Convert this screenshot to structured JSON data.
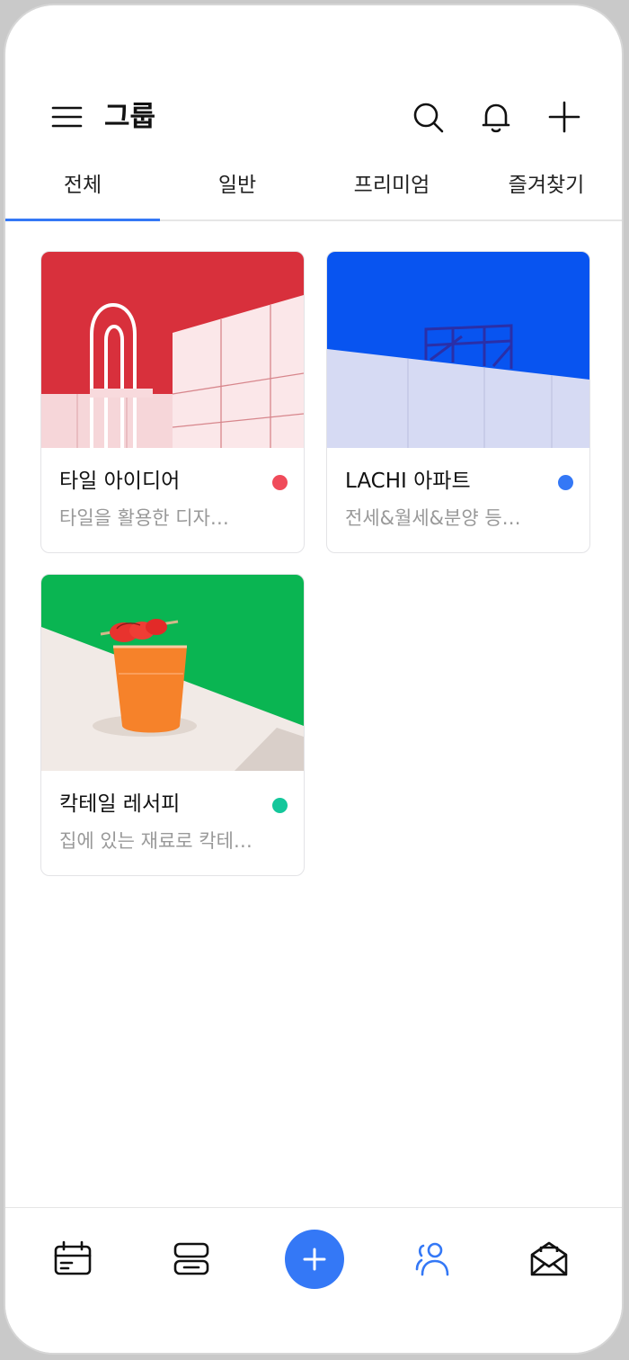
{
  "header": {
    "title": "그룹",
    "icons": [
      "menu-icon",
      "search-icon",
      "bell-icon",
      "plus-icon"
    ]
  },
  "tabs": [
    {
      "label": "전체",
      "active": true
    },
    {
      "label": "일반",
      "active": false
    },
    {
      "label": "프리미엄",
      "active": false
    },
    {
      "label": "즐겨찾기",
      "active": false
    }
  ],
  "groups": [
    {
      "title": "타일 아이디어",
      "desc": "타일을 활용한 디자…",
      "dot_color": "#f04b5a"
    },
    {
      "title": "LACHI 아파트",
      "desc": "전세&월세&분양 등…",
      "dot_color": "#3478f6"
    },
    {
      "title": "칵테일 레서피",
      "desc": "집에 있는 재료로 칵테…",
      "dot_color": "#14c79b"
    }
  ],
  "bottom_nav": {
    "icons": [
      "calendar-icon",
      "list-icon",
      "plus-icon",
      "people-icon",
      "mail-icon"
    ],
    "active": "people-icon"
  },
  "colors": {
    "accent": "#3478f6",
    "text_primary": "#111111",
    "text_secondary": "#999999"
  }
}
